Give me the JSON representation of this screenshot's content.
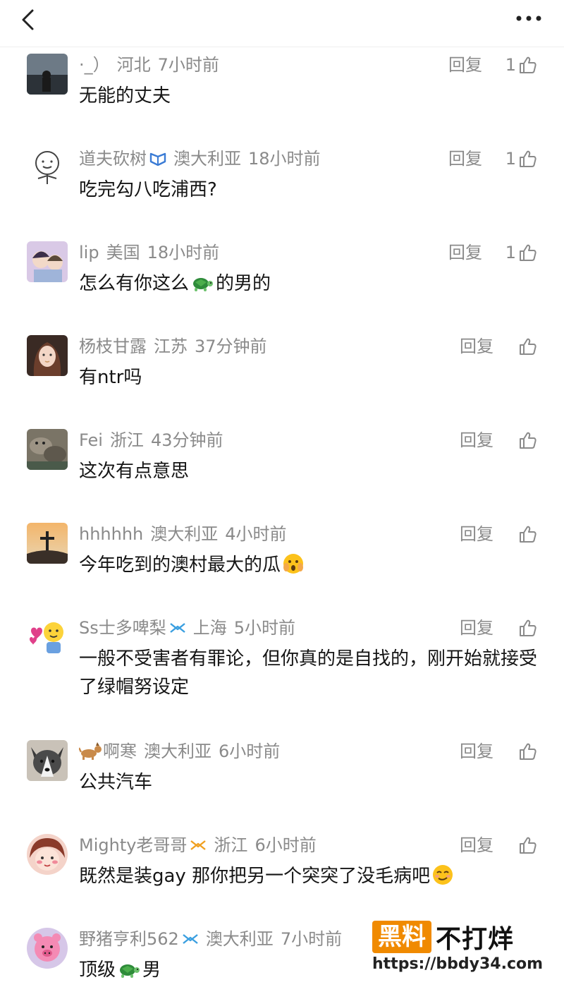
{
  "header": {
    "back_icon": "chevron-left-icon",
    "more_icon": "more-dots-icon"
  },
  "comments": [
    {
      "user": "·_）",
      "location": "河北",
      "time": "7小时前",
      "text": "无能的丈夫",
      "reply": "回复",
      "likes": "1"
    },
    {
      "user": "道夫砍树",
      "location": "澳大利亚",
      "time": "18小时前",
      "text": "吃完勾八吃浦西?",
      "reply": "回复",
      "likes": "1"
    },
    {
      "user": "lip",
      "location": "美国",
      "time": "18小时前",
      "text_a": "怎么有你这么",
      "text_b": "的男的",
      "reply": "回复",
      "likes": "1"
    },
    {
      "user": "杨枝甘露",
      "location": "江苏",
      "time": "37分钟前",
      "text": "有ntr吗",
      "reply": "回复",
      "likes": ""
    },
    {
      "user": "Fei",
      "location": "浙江",
      "time": "43分钟前",
      "text": "这次有点意思",
      "reply": "回复",
      "likes": ""
    },
    {
      "user": "hhhhhh",
      "location": "澳大利亚",
      "time": "4小时前",
      "text": "今年吃到的澳村最大的瓜",
      "reply": "回复",
      "likes": ""
    },
    {
      "user": "Ss士多啤梨",
      "location": "上海",
      "time": "5小时前",
      "text": "一般不受害者有罪论，但你真的是自找的，刚开始就接受了绿帽努设定",
      "reply": "回复",
      "likes": ""
    },
    {
      "user": "啊寒",
      "location": "澳大利亚",
      "time": "6小时前",
      "text": "公共汽车",
      "reply": "回复",
      "likes": ""
    },
    {
      "user": "Mighty老哥哥",
      "location": "浙江",
      "time": "6小时前",
      "text": "既然是装gay 那你把另一个突突了没毛病吧",
      "reply": "回复",
      "likes": ""
    },
    {
      "user": "野猪亨利562",
      "location": "澳大利亚",
      "time": "7小时前",
      "text_a": "顶级",
      "text_b": "男",
      "reply": "",
      "likes": ""
    }
  ],
  "watermark": {
    "brand_a": "黑料",
    "brand_b": "不打烊",
    "url": "https://bbdy34.com"
  },
  "colors": {
    "meta_gray": "#8a8a8a",
    "badge_blue": "#3a7bd5",
    "badge_gold": "#f0a020",
    "watermark_orange": "#f08a00"
  }
}
